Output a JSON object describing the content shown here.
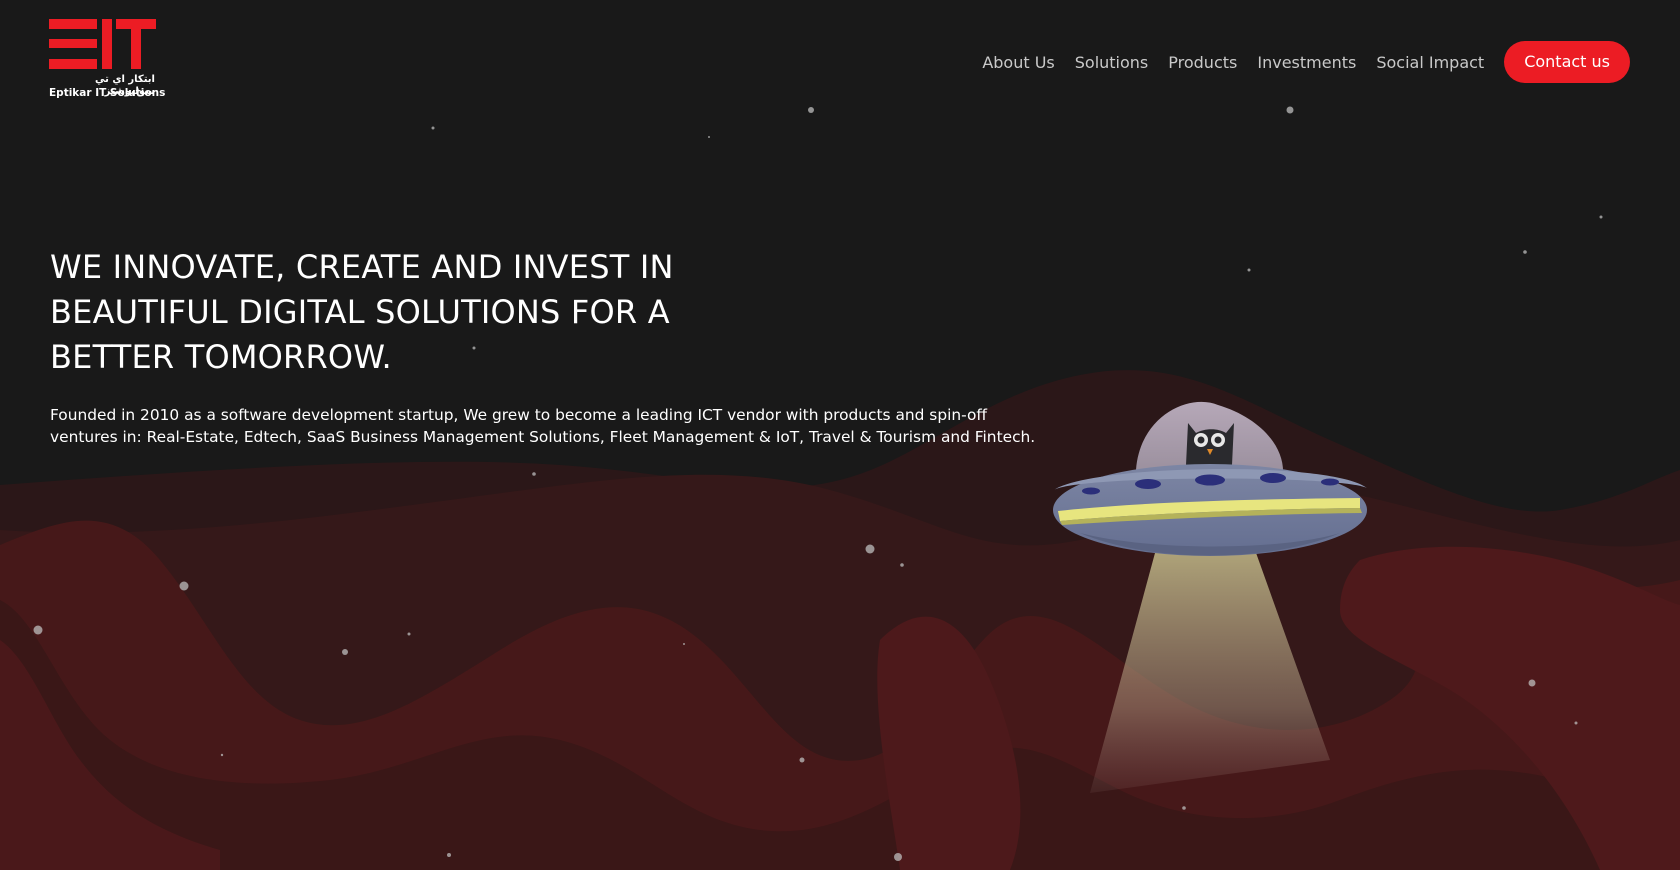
{
  "brand": {
    "logo_mark": "EIT",
    "arabic_name": "ابتكار اي تي سوليوشنز",
    "name": "Eptikar IT Solutions",
    "accent_color": "#ec1c24",
    "background_color": "#191919"
  },
  "nav": {
    "items": [
      {
        "label": "About Us"
      },
      {
        "label": "Solutions"
      },
      {
        "label": "Products"
      },
      {
        "label": "Investments"
      },
      {
        "label": "Social Impact"
      }
    ],
    "contact_label": "Contact us"
  },
  "hero": {
    "title": "WE INNOVATE, CREATE AND INVEST IN BEAUTIFUL DIGITAL SOLUTIONS FOR A BETTER TOMORROW.",
    "description": "Founded in 2010 as a software development startup, We grew to become a leading ICT vendor with products and spin-off ventures in: Real-Estate, Edtech, SaaS Business Management Solutions, Fleet Management & IoT, Travel & Tourism and Fintech."
  },
  "illustration": {
    "icon": "ufo-owl-illustration"
  }
}
